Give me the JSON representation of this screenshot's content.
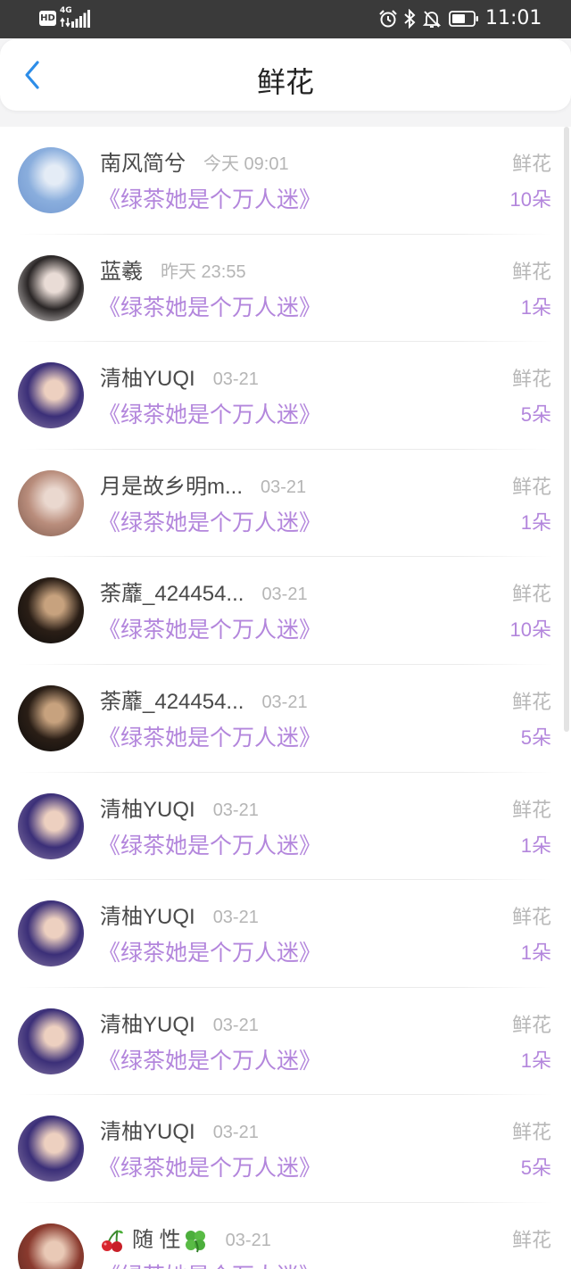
{
  "status_bar": {
    "hd_badge": "HD",
    "network_type": "4G",
    "time": "11:01",
    "icons": [
      "signal-icon",
      "alarm-icon",
      "bluetooth-icon",
      "mute-bell-icon",
      "battery-icon"
    ]
  },
  "header": {
    "title": "鲜花",
    "back_icon": "chevron-left-icon"
  },
  "theme": {
    "status_bar_bg": "#3a3a3a",
    "accent_blue": "#2d8de8",
    "book_purple": "#b386dc",
    "muted_gray": "#b5b5b5",
    "name_color": "#4a4a4a"
  },
  "list": {
    "items": [
      {
        "name": "南风简兮",
        "time": "今天 09:01",
        "book": "《绿茶她是个万人迷》",
        "gift": "鲜花",
        "count": "10朵",
        "avatar": [
          "#8aaedd",
          "#e4ecf6",
          "#6f95cf"
        ]
      },
      {
        "name": "蓝羲",
        "time": "昨天 23:55",
        "book": "《绿茶她是个万人迷》",
        "gift": "鲜花",
        "count": "1朵",
        "avatar": [
          "#2a2626",
          "#e9dcd6",
          "#efebea"
        ]
      },
      {
        "name": "清柚YUQI",
        "time": "03-21",
        "book": "《绿茶她是个万人迷》",
        "gift": "鲜花",
        "count": "5朵",
        "avatar": [
          "#3b2f78",
          "#edd0c0",
          "#8f7fa8"
        ]
      },
      {
        "name": "月是故乡明m...",
        "time": "03-21",
        "book": "《绿茶她是个万人迷》",
        "gift": "鲜花",
        "count": "1朵",
        "avatar": [
          "#b98d7c",
          "#ead8cf",
          "#7d5a4d"
        ]
      },
      {
        "name": "荼蘼_424454...",
        "time": "03-21",
        "book": "《绿茶她是个万人迷》",
        "gift": "鲜花",
        "count": "10朵",
        "avatar": [
          "#2a1e16",
          "#c7a27e",
          "#0b0b0b"
        ]
      },
      {
        "name": "荼蘼_424454...",
        "time": "03-21",
        "book": "《绿茶她是个万人迷》",
        "gift": "鲜花",
        "count": "5朵",
        "avatar": [
          "#2a1e16",
          "#c7a27e",
          "#0b0b0b"
        ]
      },
      {
        "name": "清柚YUQI",
        "time": "03-21",
        "book": "《绿茶她是个万人迷》",
        "gift": "鲜花",
        "count": "1朵",
        "avatar": [
          "#3b2f78",
          "#edd0c0",
          "#8f7fa8"
        ]
      },
      {
        "name": "清柚YUQI",
        "time": "03-21",
        "book": "《绿茶她是个万人迷》",
        "gift": "鲜花",
        "count": "1朵",
        "avatar": [
          "#3b2f78",
          "#edd0c0",
          "#8f7fa8"
        ]
      },
      {
        "name": "清柚YUQI",
        "time": "03-21",
        "book": "《绿茶她是个万人迷》",
        "gift": "鲜花",
        "count": "1朵",
        "avatar": [
          "#3b2f78",
          "#edd0c0",
          "#8f7fa8"
        ]
      },
      {
        "name": "清柚YUQI",
        "time": "03-21",
        "book": "《绿茶她是个万人迷》",
        "gift": "鲜花",
        "count": "5朵",
        "avatar": [
          "#3b2f78",
          "#edd0c0",
          "#8f7fa8"
        ]
      },
      {
        "name": "随 性",
        "name_prefix_icon": "cherry-icon",
        "name_suffix_icon": "four-leaf-clover-icon",
        "time": "03-21",
        "book": "《绿茶她是个万人迷》",
        "gift": "鲜花",
        "count": "",
        "avatar": [
          "#8a3a2e",
          "#e9c9b6",
          "#5a2a22"
        ]
      }
    ]
  }
}
